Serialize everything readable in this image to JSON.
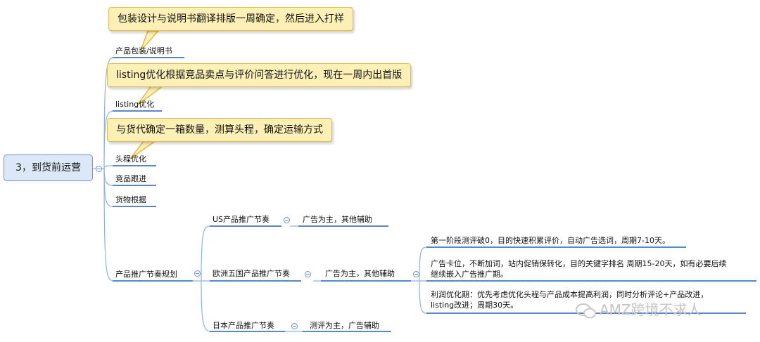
{
  "root": {
    "label": "3，到货前运营"
  },
  "branches": [
    {
      "label": "产品包装/说明书",
      "callout": "包装设计与说明书翻译排版一周确定，然后进入打样"
    },
    {
      "label": "listing优化",
      "callout": "listing优化根据竞品卖点与评价问答进行优化，现在一周内出首版"
    },
    {
      "label": "头程优化",
      "callout": "与货代确定一箱数量，测算头程，确定运输方式"
    },
    {
      "label": "竞品跟进"
    },
    {
      "label": "货物根据"
    },
    {
      "label": "产品推广节奏规划"
    }
  ],
  "promotion": [
    {
      "label": "US产品推广节奏",
      "child": "广告为主，其他辅助"
    },
    {
      "label": "欧洲五国产品推广节奏",
      "child": "广告为主，其他辅助",
      "phases": [
        {
          "text": "第一阶段测评破0，目的快速积累评价，自动广告选词，周期7-10天。"
        },
        {
          "line1": "广告卡位，不断加词，站内促销保转化，目的关键字排名 周期15-20天，如有必要后续",
          "line2": "继续嵌入广告推广期。"
        },
        {
          "line1": "利润优化期：优先考虑优化头程与产品成本提高利润，同时分析评论+产品改进，",
          "line2": "listing改进；周期30天。"
        }
      ]
    },
    {
      "label": "日本产品推广节奏",
      "child": "测评为主，广告辅助"
    }
  ],
  "watermark": "AMZ跨境不求人",
  "colors": {
    "connector": "#8eb1de",
    "underline": "#5b87c6",
    "callout_fill": "#fdf0b7",
    "callout_border": "#e8b94c",
    "root_fill": "#dce8f7"
  }
}
